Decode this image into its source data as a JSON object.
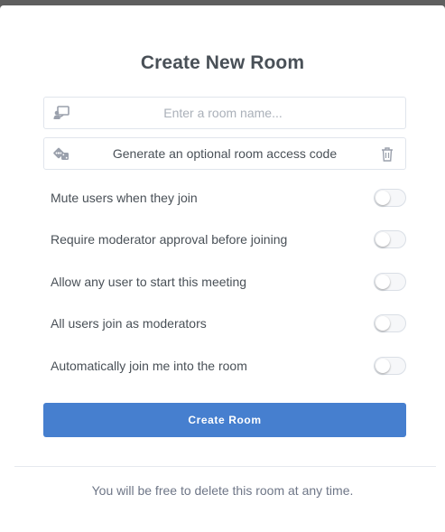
{
  "modal": {
    "title": "Create New Room"
  },
  "room_name": {
    "placeholder": "Enter a room name...",
    "value": "",
    "icon": "chalkboard-teacher-icon"
  },
  "access_code": {
    "label": "Generate an optional room access code",
    "icon": "dice-icon",
    "delete_icon": "trash-icon"
  },
  "options": [
    {
      "label": "Mute users when they join",
      "enabled": false
    },
    {
      "label": "Require moderator approval before joining",
      "enabled": false
    },
    {
      "label": "Allow any user to start this meeting",
      "enabled": false
    },
    {
      "label": "All users join as moderators",
      "enabled": false
    },
    {
      "label": "Automatically join me into the room",
      "enabled": false
    }
  ],
  "create_button": {
    "label": "Create Room"
  },
  "footer": {
    "note": "You will be free to delete this room at any time."
  },
  "colors": {
    "primary": "#467fcf",
    "text": "#495057",
    "muted": "#6e7687",
    "overlay": "#5f5f5f"
  }
}
